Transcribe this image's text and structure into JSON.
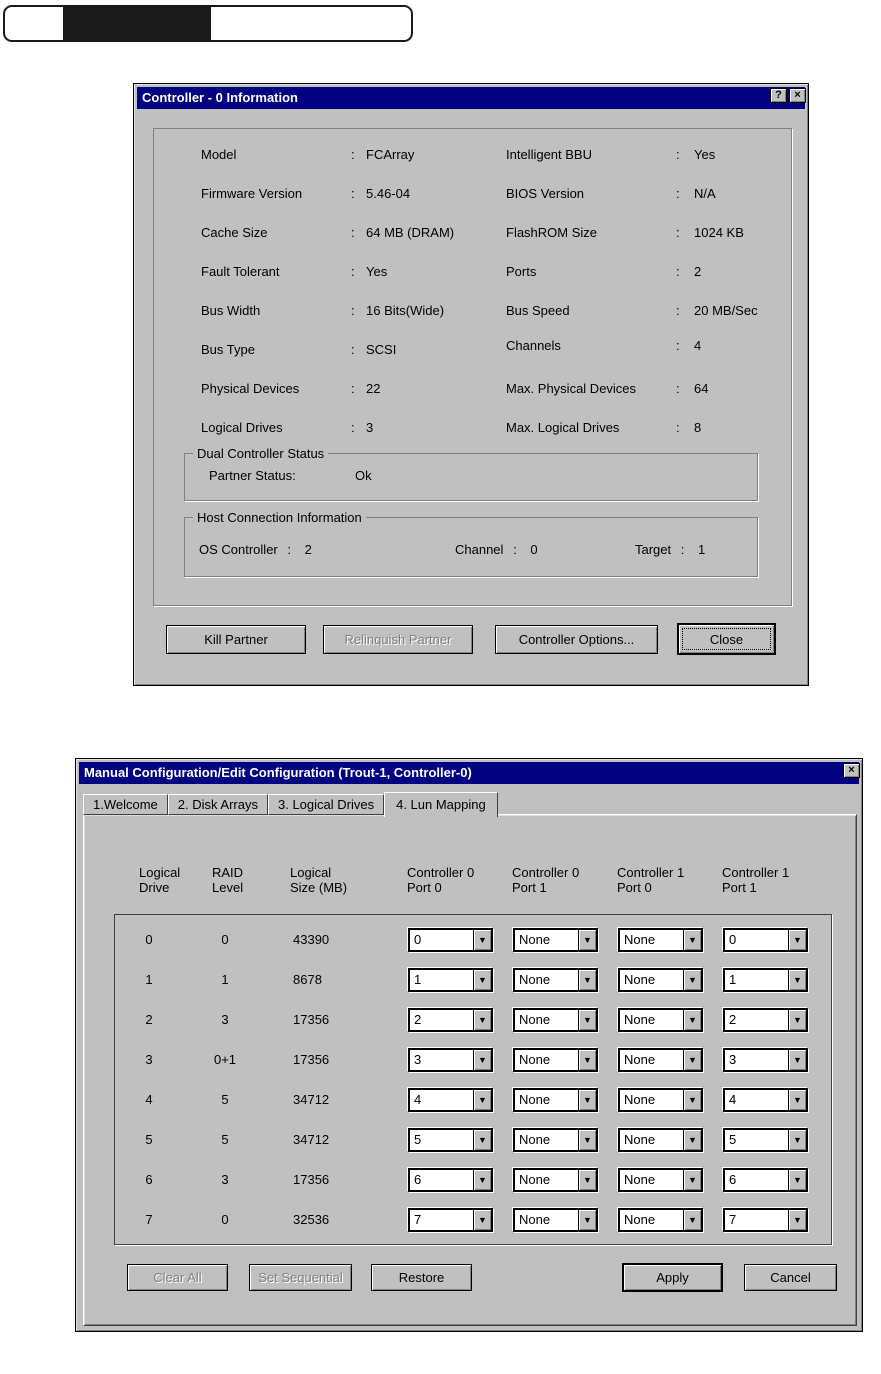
{
  "ui": {
    "colon": ":",
    "arrow_glyph": "▼",
    "help_glyph": "?",
    "close_glyph": "×"
  },
  "controller_info_dialog": {
    "title": "Controller - 0 Information",
    "rows": [
      {
        "left_label": "Model",
        "left_value": "FCArray",
        "right_label": "Intelligent BBU",
        "right_value": "Yes"
      },
      {
        "left_label": "Firmware Version",
        "left_value": "5.46-04",
        "right_label": "BIOS Version",
        "right_value": "N/A"
      },
      {
        "left_label": "Cache Size",
        "left_value": "64 MB (DRAM)",
        "right_label": "FlashROM Size",
        "right_value": "1024 KB"
      },
      {
        "left_label": "Fault Tolerant",
        "left_value": "Yes",
        "right_label": "Ports",
        "right_value": "2"
      },
      {
        "left_label": "Bus Width",
        "left_value": "16 Bits(Wide)",
        "right_label": "Bus Speed",
        "right_value": "20 MB/Sec"
      },
      {
        "left_label": "Bus Type",
        "left_value": "SCSI",
        "right_label": "Channels",
        "right_value": "4"
      },
      {
        "left_label": "Physical Devices",
        "left_value": "22",
        "right_label": "Max. Physical Devices",
        "right_value": "64"
      },
      {
        "left_label": "Logical Drives",
        "left_value": "3",
        "right_label": "Max. Logical Drives",
        "right_value": "8"
      }
    ],
    "dual_controller_status": {
      "group_title": "Dual Controller Status",
      "partner_status_label": "Partner Status:",
      "partner_status_value": "Ok"
    },
    "host_connection": {
      "group_title": "Host Connection Information",
      "fields": [
        {
          "label": "OS Controller",
          "value": "2"
        },
        {
          "label": "Channel",
          "value": "0"
        },
        {
          "label": "Target",
          "value": "1"
        }
      ]
    },
    "buttons": {
      "kill_partner": "Kill Partner",
      "relinquish_partner": "Relinquish Partner",
      "controller_options": "Controller Options...",
      "close": "Close"
    }
  },
  "config_dialog": {
    "title": "Manual Configuration/Edit Configuration (Trout-1, Controller-0)",
    "tabs": [
      {
        "label": "1.Welcome"
      },
      {
        "label": "2. Disk Arrays"
      },
      {
        "label": "3. Logical Drives"
      },
      {
        "label": "4. Lun Mapping"
      }
    ],
    "active_tab": "4. Lun Mapping",
    "columns": [
      {
        "line1": "Logical",
        "line2": "Drive"
      },
      {
        "line1": "RAID",
        "line2": "Level"
      },
      {
        "line1": "Logical",
        "line2": "Size (MB)"
      },
      {
        "line1": "Controller 0",
        "line2": "Port 0"
      },
      {
        "line1": "Controller 0",
        "line2": "Port 1"
      },
      {
        "line1": "Controller 1",
        "line2": "Port 0"
      },
      {
        "line1": "Controller 1",
        "line2": "Port 1"
      }
    ],
    "rows": [
      {
        "drive": "0",
        "raid": "0",
        "size": "43390",
        "luns": [
          "0",
          "None",
          "None",
          "0"
        ]
      },
      {
        "drive": "1",
        "raid": "1",
        "size": "8678",
        "luns": [
          "1",
          "None",
          "None",
          "1"
        ]
      },
      {
        "drive": "2",
        "raid": "3",
        "size": "17356",
        "luns": [
          "2",
          "None",
          "None",
          "2"
        ]
      },
      {
        "drive": "3",
        "raid": "0+1",
        "size": "17356",
        "luns": [
          "3",
          "None",
          "None",
          "3"
        ]
      },
      {
        "drive": "4",
        "raid": "5",
        "size": "34712",
        "luns": [
          "4",
          "None",
          "None",
          "4"
        ]
      },
      {
        "drive": "5",
        "raid": "5",
        "size": "34712",
        "luns": [
          "5",
          "None",
          "None",
          "5"
        ]
      },
      {
        "drive": "6",
        "raid": "3",
        "size": "17356",
        "luns": [
          "6",
          "None",
          "None",
          "6"
        ]
      },
      {
        "drive": "7",
        "raid": "0",
        "size": "32536",
        "luns": [
          "7",
          "None",
          "None",
          "7"
        ]
      }
    ],
    "buttons": {
      "clear_all": "Clear All",
      "set_sequential": "Set Sequential",
      "restore": "Restore",
      "apply": "Apply",
      "cancel": "Cancel"
    }
  }
}
